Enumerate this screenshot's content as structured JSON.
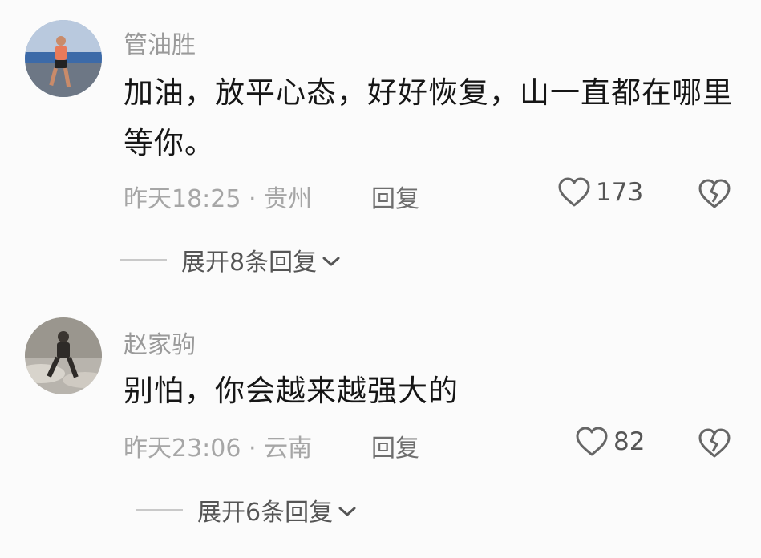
{
  "comments": [
    {
      "username": "管油胜",
      "text": "加油，放平心态，好好恢复，山一直都在哪里等你。",
      "meta": "昨天18:25 · 贵州",
      "reply_label": "回复",
      "likes": "173",
      "expand_label": "展开8条回复"
    },
    {
      "username": "赵家驹",
      "text": "别怕，你会越来越强大的",
      "meta": "昨天23:06 · 云南",
      "reply_label": "回复",
      "likes": "82",
      "expand_label": "展开6条回复"
    }
  ],
  "icons": {
    "like": "heart-outline-icon",
    "dislike": "broken-heart-icon",
    "expand": "chevron-down-icon"
  },
  "colors": {
    "background": "#fbfbfb",
    "username": "#9a9a9a",
    "text": "#161616",
    "meta": "#a6a6a6"
  }
}
